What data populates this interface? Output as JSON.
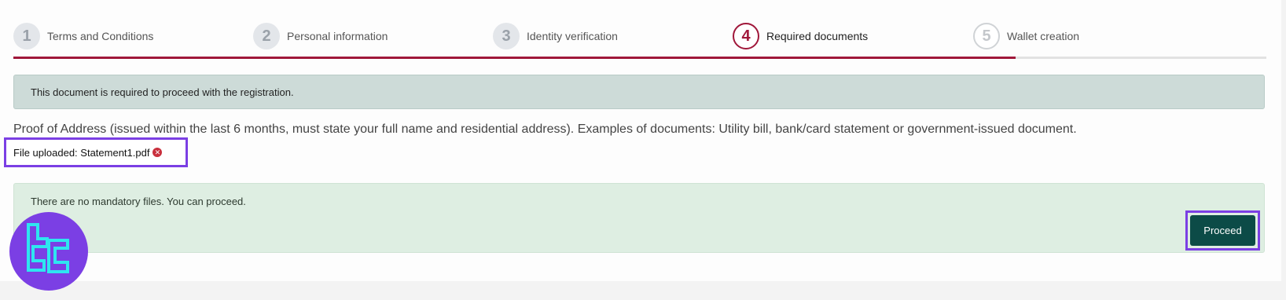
{
  "stepper": {
    "steps": [
      {
        "number": "1",
        "label": "Terms and Conditions",
        "state": "done"
      },
      {
        "number": "2",
        "label": "Personal information",
        "state": "done"
      },
      {
        "number": "3",
        "label": "Identity verification",
        "state": "done"
      },
      {
        "number": "4",
        "label": "Required documents",
        "state": "active"
      },
      {
        "number": "5",
        "label": "Wallet creation",
        "state": "todo"
      }
    ],
    "progress_fraction": 0.8
  },
  "notice": {
    "text": "This document is required to proceed with the registration."
  },
  "document": {
    "description": "Proof of Address (issued within the last 6 months, must state your full name and residential address). Examples of documents: Utility bill, bank/card statement or government-issued document.",
    "file_uploaded": "File uploaded: Statement1.pdf",
    "remove_icon": "close-circle-icon"
  },
  "success": {
    "text": "There are no mandatory files. You can proceed."
  },
  "actions": {
    "proceed_label": "Proceed"
  },
  "colors": {
    "accent": "#a0173a",
    "proceed_button": "#0c4b47",
    "highlight_border": "#7b3fe4",
    "notice_bg": "#cddbd8",
    "success_bg": "#deeee2"
  }
}
